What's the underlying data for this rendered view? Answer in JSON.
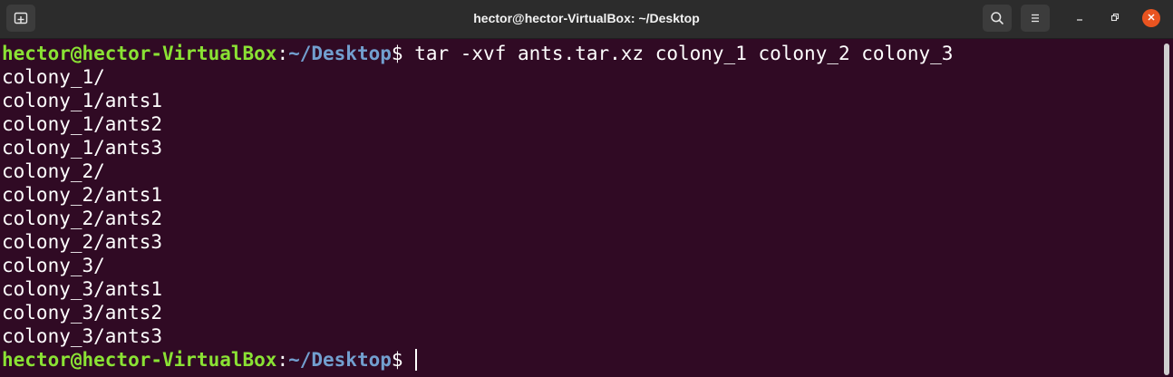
{
  "window": {
    "title": "hector@hector-VirtualBox: ~/Desktop"
  },
  "titlebar": {
    "icons": {
      "new_tab": "new-tab-icon",
      "search": "search-icon",
      "menu": "hamburger-menu-icon",
      "minimize": "minimize-icon",
      "maximize": "maximize-icon",
      "close": "close-icon"
    },
    "close_color": "#e95420"
  },
  "terminal": {
    "colors": {
      "background": "#300a24",
      "user_host": "#8ae234",
      "path": "#729fcf",
      "text": "#ffffff"
    },
    "prompt": {
      "user_host": "hector@hector-VirtualBox",
      "separator": ":",
      "path": "~/Desktop",
      "symbol": "$"
    },
    "command": " tar -xvf ants.tar.xz colony_1 colony_2 colony_3",
    "output": [
      "colony_1/",
      "colony_1/ants1",
      "colony_1/ants2",
      "colony_1/ants3",
      "colony_2/",
      "colony_2/ants1",
      "colony_2/ants2",
      "colony_2/ants3",
      "colony_3/",
      "colony_3/ants1",
      "colony_3/ants2",
      "colony_3/ants3"
    ]
  }
}
